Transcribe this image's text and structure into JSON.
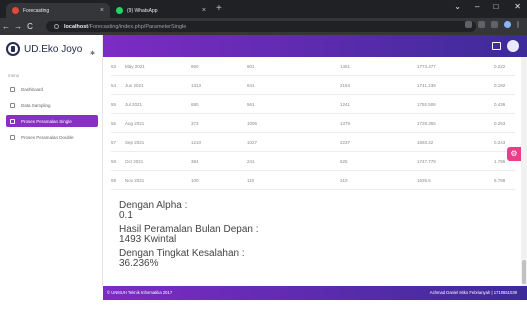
{
  "browser": {
    "tabs": [
      {
        "title": "Forecasting",
        "favicon_color": "#e8453c",
        "close": "×"
      },
      {
        "title": "(9) WhatsApp",
        "favicon_color": "#25d366",
        "close": "×"
      }
    ],
    "new_tab": "+",
    "window_controls": [
      "⌄",
      "–",
      "□",
      "✕"
    ],
    "url_host": "localhost",
    "url_path": "/Forecasting/index.php/ParameterSingle",
    "nav": [
      "←",
      "→",
      "C",
      "⌂"
    ]
  },
  "sidebar": {
    "brand": "UD.Eko Joyo",
    "pin": "✱",
    "section": "menu",
    "items": [
      {
        "label": "Dashboard",
        "active": false
      },
      {
        "label": "Data Sampling",
        "active": false
      },
      {
        "label": "Proses Peramalan Single",
        "active": true
      },
      {
        "label": "Proses Peramalan Double",
        "active": false
      }
    ]
  },
  "table": {
    "rows": [
      [
        "53",
        "May 2021",
        "850",
        "801",
        "1451",
        "1773.477",
        "0.222"
      ],
      [
        "54",
        "Jun 2021",
        "1313",
        "841",
        "2154",
        "1741.239",
        "0.192"
      ],
      [
        "55",
        "Jul 2021",
        "680",
        "561",
        "1241",
        "1792.506",
        "0.436"
      ],
      [
        "56",
        "Aug 2021",
        "373",
        "1006",
        "1379",
        "1728.355",
        "0.253"
      ],
      [
        "57",
        "Sep 2021",
        "1210",
        "1027",
        "2237",
        "1693.42",
        "0.243"
      ],
      [
        "58",
        "Oct 2021",
        "384",
        "241",
        "625",
        "1747.778",
        "1.796"
      ],
      [
        "59",
        "Nov 2021",
        "100",
        "110",
        "210",
        "1635.5",
        "6.788"
      ]
    ]
  },
  "results": {
    "alpha_label": "Dengan Alpha :",
    "alpha_value": "0.1",
    "forecast_label": "Hasil Peramalan Bulan Depan :",
    "forecast_value": "1493 Kwintal",
    "error_label": "Dengan Tingkat Kesalahan :",
    "error_value": "36.236%"
  },
  "footer": {
    "left": "© UNMUH Teknik Informatika 2017",
    "right": "Achmad Daniel Miko Febrianyah | 1710651039"
  },
  "settings_icon": "⚙",
  "colors": {
    "accent_purple": "#8a2fc6",
    "header_start": "#7d2bc4",
    "header_end": "#3d2b99",
    "fab_pink": "#e83e8c"
  }
}
